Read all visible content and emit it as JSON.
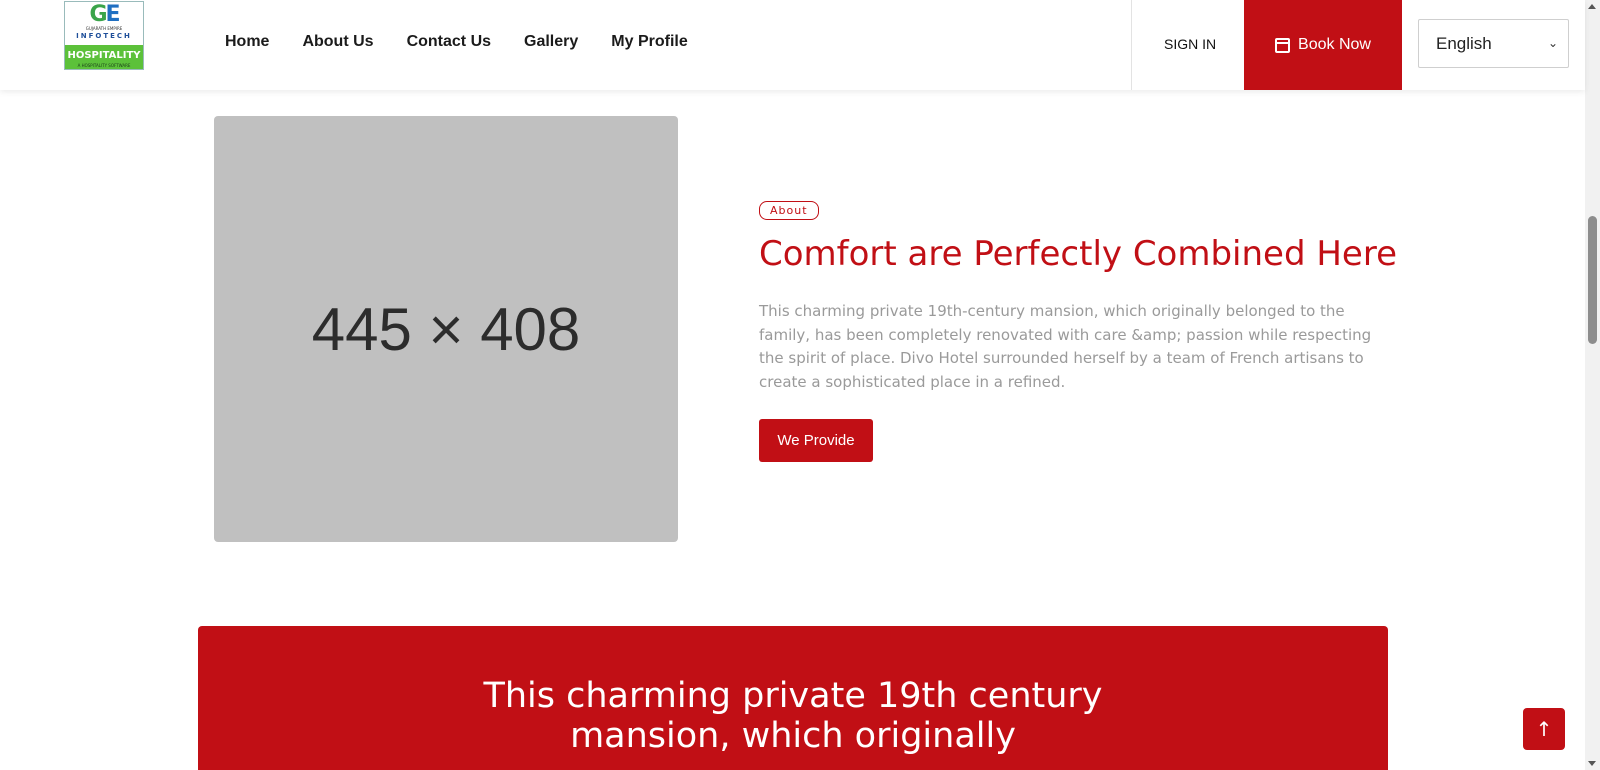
{
  "brand": {
    "logo_mark": "GE",
    "logo_line1": "GUJARATH EMPIRE",
    "logo_line2": "INFOTECH",
    "logo_hospitality": "HOSPITALITY",
    "logo_tagline": "A HOSPITALITY SOFTWARE"
  },
  "nav": {
    "items": [
      "Home",
      "About Us",
      "Contact Us",
      "Gallery",
      "My Profile"
    ]
  },
  "header": {
    "signin_label": "SIGN IN",
    "book_label": "Book Now",
    "language_selected": "English"
  },
  "about": {
    "placeholder_text": "445 × 408",
    "tag": "About",
    "title": "Comfort are Perfectly Combined Here",
    "description": "This charming private 19th-century mansion, which originally belonged to the family, has been completely renovated with care &amp; passion while respecting the spirit of place. Divo Hotel surrounded herself by a team of French artisans to create a sophisticated place in a refined.",
    "button_label": "We Provide"
  },
  "banner": {
    "text": "This charming private 19th century mansion, which originally"
  },
  "colors": {
    "accent": "#c10f15",
    "placeholder": "#c0c0c0"
  }
}
